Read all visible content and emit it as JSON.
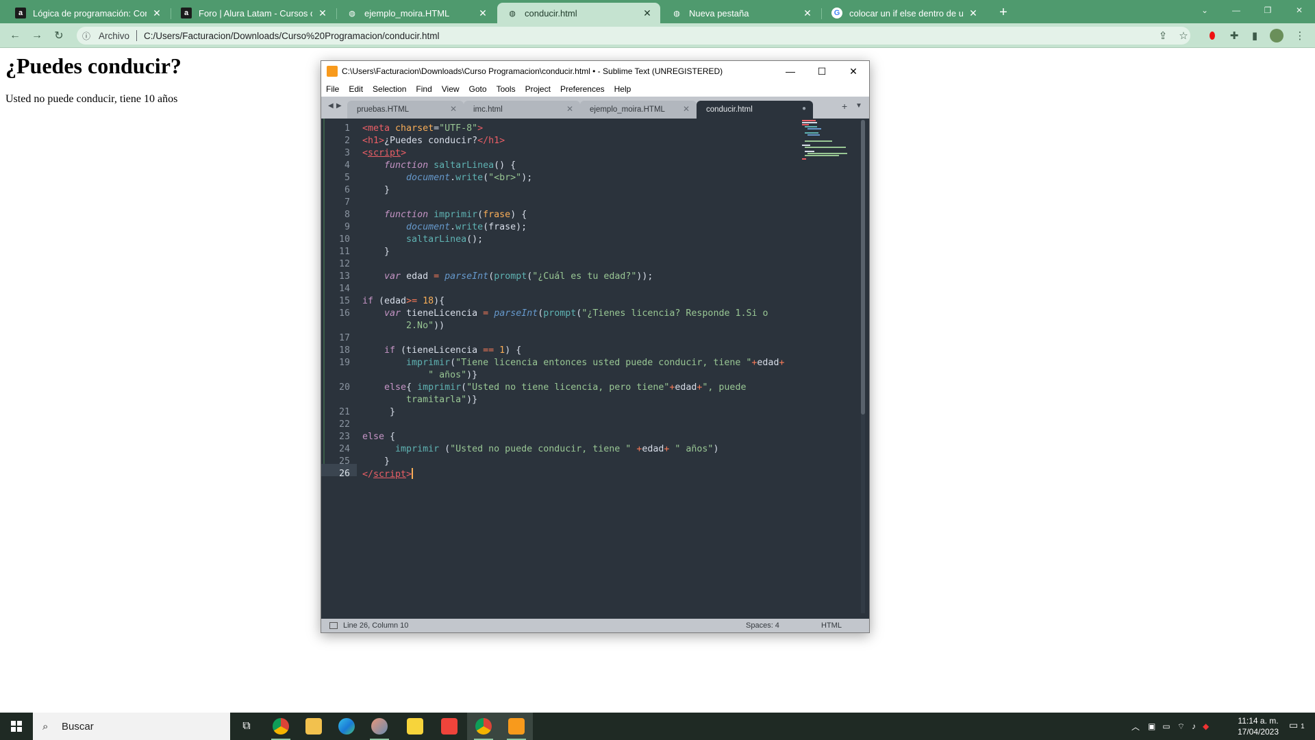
{
  "browser": {
    "tabs": [
      {
        "title": "Lógica de programación: Conce",
        "favicon": "alura-icon",
        "glyph": "a",
        "active": false
      },
      {
        "title": "Foro | Alura Latam - Cursos onlin",
        "favicon": "alura-icon",
        "glyph": "a",
        "active": false
      },
      {
        "title": "ejemplo_moira.HTML",
        "favicon": "globe-icon",
        "glyph": "◍",
        "active": false
      },
      {
        "title": "conducir.html",
        "favicon": "globe-icon",
        "glyph": "◍",
        "active": true
      },
      {
        "title": "Nueva pestaña",
        "favicon": "globe-icon",
        "glyph": "◍",
        "active": false
      },
      {
        "title": "colocar un if else dentro de un if",
        "favicon": "google-icon",
        "glyph": "G",
        "active": false
      }
    ],
    "new_tab": "+",
    "address": {
      "scheme_label": "Archivo",
      "url": "C:/Users/Facturacion/Downloads/Curso%20Programacion/conducir.html"
    },
    "colors": {
      "frame": "#4f9a6e",
      "toolbar": "#c5e3d0"
    }
  },
  "page": {
    "heading": "¿Puedes conducir?",
    "paragraph": "Usted no puede conducir, tiene 10 años"
  },
  "sublime": {
    "title": "C:\\Users\\Facturacion\\Downloads\\Curso Programacion\\conducir.html • - Sublime Text (UNREGISTERED)",
    "menu": [
      "File",
      "Edit",
      "Selection",
      "Find",
      "View",
      "Goto",
      "Tools",
      "Project",
      "Preferences",
      "Help"
    ],
    "tabs": [
      {
        "label": "pruebas.HTML",
        "active": false
      },
      {
        "label": "imc.html",
        "active": false
      },
      {
        "label": "ejemplo_moira.HTML",
        "active": false
      },
      {
        "label": "conducir.html",
        "active": true,
        "dirty": true
      }
    ],
    "line_numbers": [
      "1",
      "2",
      "3",
      "4",
      "5",
      "6",
      "7",
      "8",
      "9",
      "10",
      "11",
      "12",
      "13",
      "14",
      "15",
      "16",
      "",
      "17",
      "18",
      "19",
      "",
      "20",
      "",
      "21",
      "22",
      "23",
      "24",
      "25",
      "26"
    ],
    "current_line": "26",
    "status": {
      "position": "Line 26, Column 10",
      "indent": "Spaces: 4",
      "syntax": "HTML"
    }
  },
  "taskbar": {
    "search_placeholder": "Buscar",
    "clock_time": "11:14 a. m.",
    "clock_date": "17/04/2023",
    "notification_count": "1"
  }
}
